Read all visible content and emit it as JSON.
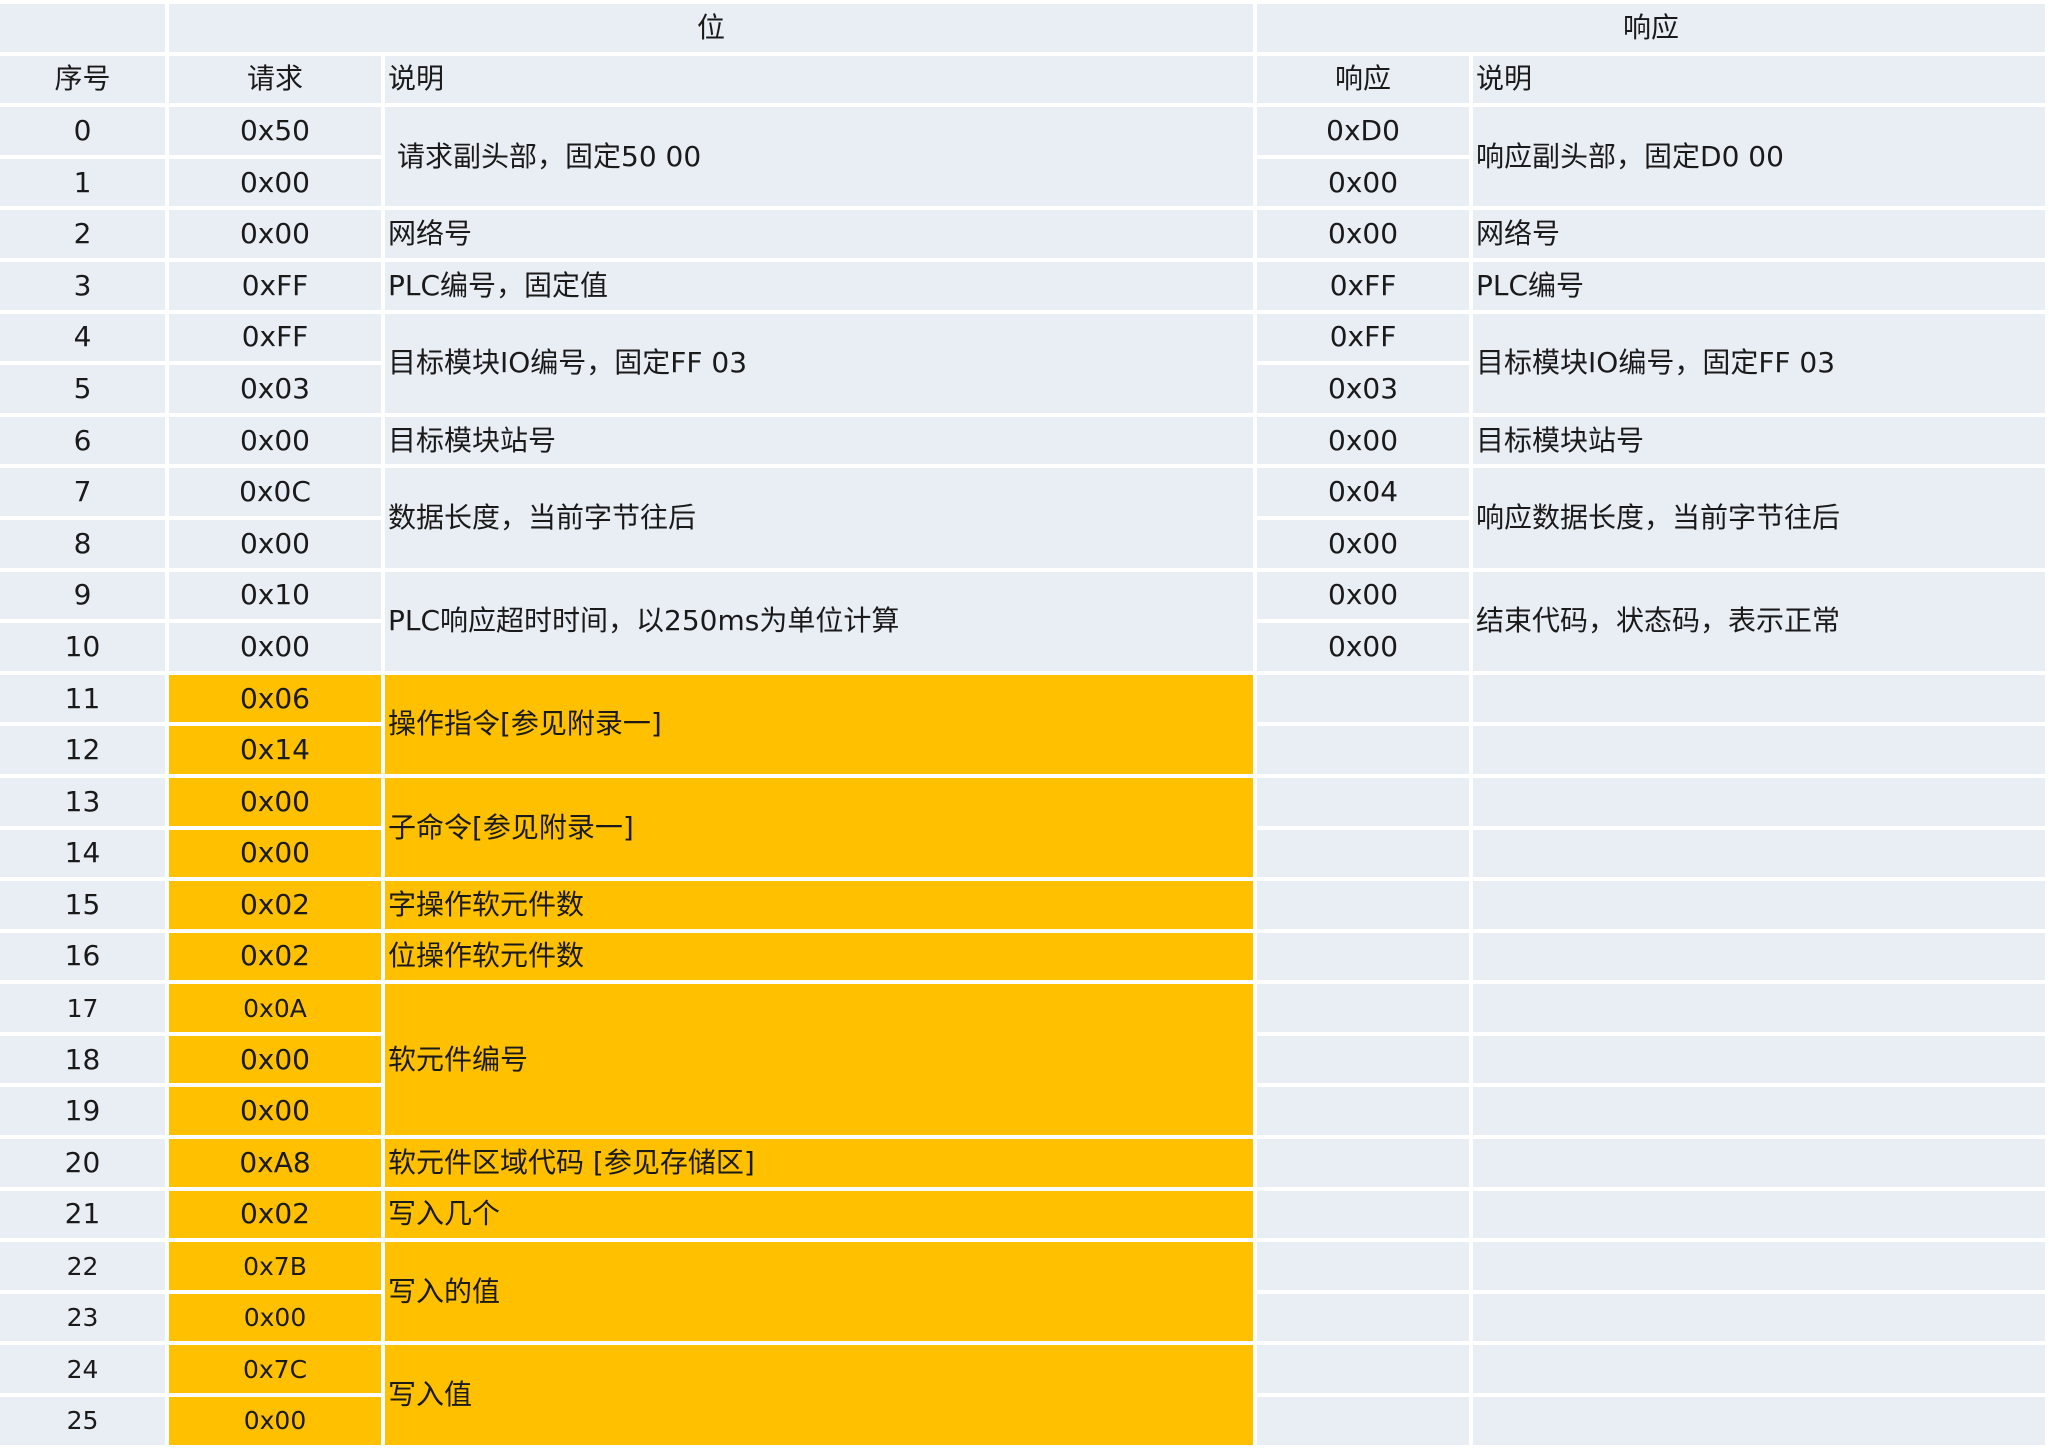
{
  "header_groups": {
    "corner": "",
    "request_group": "位",
    "response_group": "响应"
  },
  "columns": {
    "seq": "序号",
    "request": "请求",
    "req_desc": "说明",
    "response": "响应",
    "resp_desc": "说明"
  },
  "rows": [
    {
      "seq": "0",
      "req": "0x50",
      "resp": "0xD0"
    },
    {
      "seq": "1",
      "req": "0x00",
      "resp": "0x00"
    },
    {
      "seq": "2",
      "req": "0x00",
      "resp": "0x00"
    },
    {
      "seq": "3",
      "req": "0xFF",
      "resp": "0xFF"
    },
    {
      "seq": "4",
      "req": "0xFF",
      "resp": "0xFF"
    },
    {
      "seq": "5",
      "req": "0x03",
      "resp": "0x03"
    },
    {
      "seq": "6",
      "req": "0x00",
      "resp": "0x00"
    },
    {
      "seq": "7",
      "req": "0x0C",
      "resp": "0x04"
    },
    {
      "seq": "8",
      "req": "0x00",
      "resp": "0x00"
    },
    {
      "seq": "9",
      "req": "0x10",
      "resp": "0x00"
    },
    {
      "seq": "10",
      "req": "0x00",
      "resp": "0x00"
    },
    {
      "seq": "11",
      "req": "0x06",
      "resp": ""
    },
    {
      "seq": "12",
      "req": "0x14",
      "resp": ""
    },
    {
      "seq": "13",
      "req": "0x00",
      "resp": ""
    },
    {
      "seq": "14",
      "req": "0x00",
      "resp": ""
    },
    {
      "seq": "15",
      "req": "0x02",
      "resp": ""
    },
    {
      "seq": "16",
      "req": "0x02",
      "resp": ""
    },
    {
      "seq": "17",
      "req": "0x0A",
      "resp": ""
    },
    {
      "seq": "18",
      "req": "0x00",
      "resp": ""
    },
    {
      "seq": "19",
      "req": "0x00",
      "resp": ""
    },
    {
      "seq": "20",
      "req": "0xA8",
      "resp": ""
    },
    {
      "seq": "21",
      "req": "0x02",
      "resp": ""
    },
    {
      "seq": "22",
      "req": "0x7B",
      "resp": ""
    },
    {
      "seq": "23",
      "req": "0x00",
      "resp": ""
    },
    {
      "seq": "24",
      "req": "0x7C",
      "resp": ""
    },
    {
      "seq": "25",
      "req": "0x00",
      "resp": ""
    }
  ],
  "request_descriptions": [
    {
      "text": "请求副头部，固定50 00"
    },
    {
      "text": "网络号"
    },
    {
      "text": "PLC编号，固定值"
    },
    {
      "text": "目标模块IO编号，固定FF 03"
    },
    {
      "text": "目标模块站号"
    },
    {
      "text": "数据长度，当前字节往后"
    },
    {
      "text": "PLC响应超时时间，以250ms为单位计算"
    },
    {
      "text": "操作指令[参见附录一]"
    },
    {
      "text": "子命令[参见附录一]"
    },
    {
      "text": "字操作软元件数"
    },
    {
      "text": "位操作软元件数"
    },
    {
      "text": "软元件编号"
    },
    {
      "text": "软元件区域代码 [参见存储区]"
    },
    {
      "text": "写入几个"
    },
    {
      "text": "写入的值"
    },
    {
      "text": "写入值"
    }
  ],
  "response_descriptions": [
    {
      "text": "响应副头部，固定D0 00"
    },
    {
      "text": "网络号"
    },
    {
      "text": "PLC编号"
    },
    {
      "text": "目标模块IO编号，固定FF 03"
    },
    {
      "text": "目标模块站号"
    },
    {
      "text": "响应数据长度，当前字节往后"
    },
    {
      "text": "结束代码，状态码，表示正常"
    }
  ],
  "colors": {
    "cell_background": "#e9eef5",
    "highlight": "#ffc000",
    "text": "#1a1a1a"
  }
}
